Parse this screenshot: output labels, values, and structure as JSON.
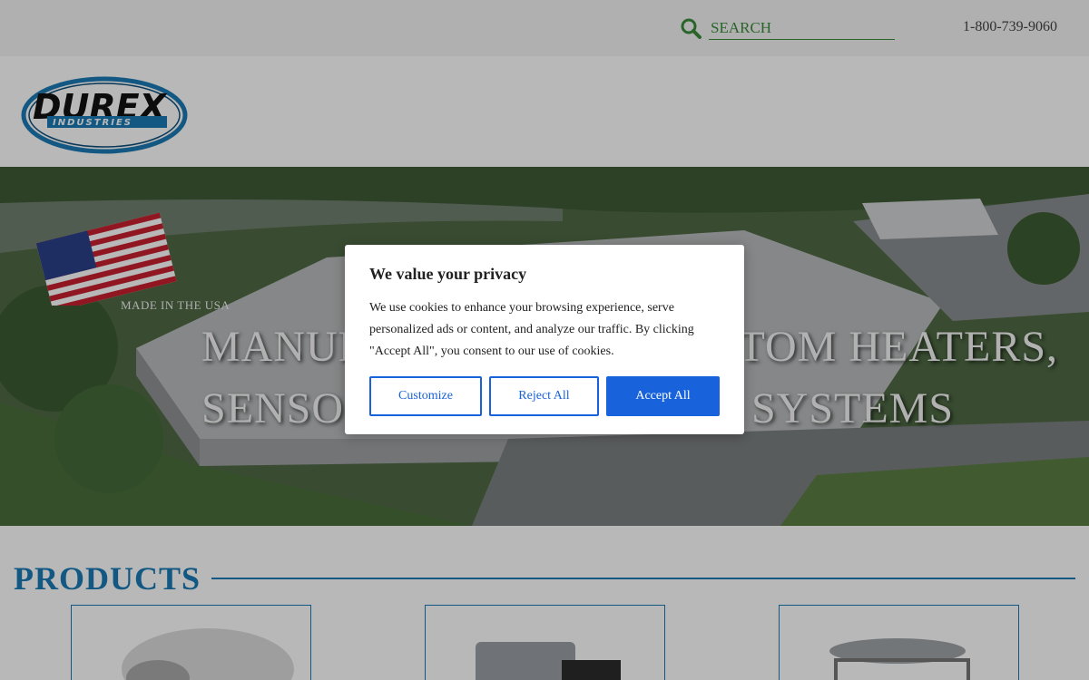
{
  "topbar": {
    "search_placeholder": "SEARCH",
    "phone": "1-800-739-9060"
  },
  "header": {
    "logo_text": "DUREX",
    "logo_subtext": "INDUSTRIES"
  },
  "hero": {
    "made_in_usa": "MADE IN THE USA",
    "headline_line1": "MANUFACTURER OF CUSTOM HEATERS,",
    "headline_line2": "SENSORS, AND CONTROL SYSTEMS"
  },
  "products": {
    "title": "PRODUCTS"
  },
  "cookie_modal": {
    "title": "We value your privacy",
    "body": "We use cookies to enhance your browsing experience, serve personalized ads or content, and analyze our traffic. By clicking \"Accept All\", you consent to our use of cookies.",
    "customize_label": "Customize",
    "reject_label": "Reject All",
    "accept_label": "Accept All"
  },
  "colors": {
    "brand_blue": "#1a7ab5",
    "search_green": "#3a8c3a",
    "consent_blue": "#1863dc"
  }
}
